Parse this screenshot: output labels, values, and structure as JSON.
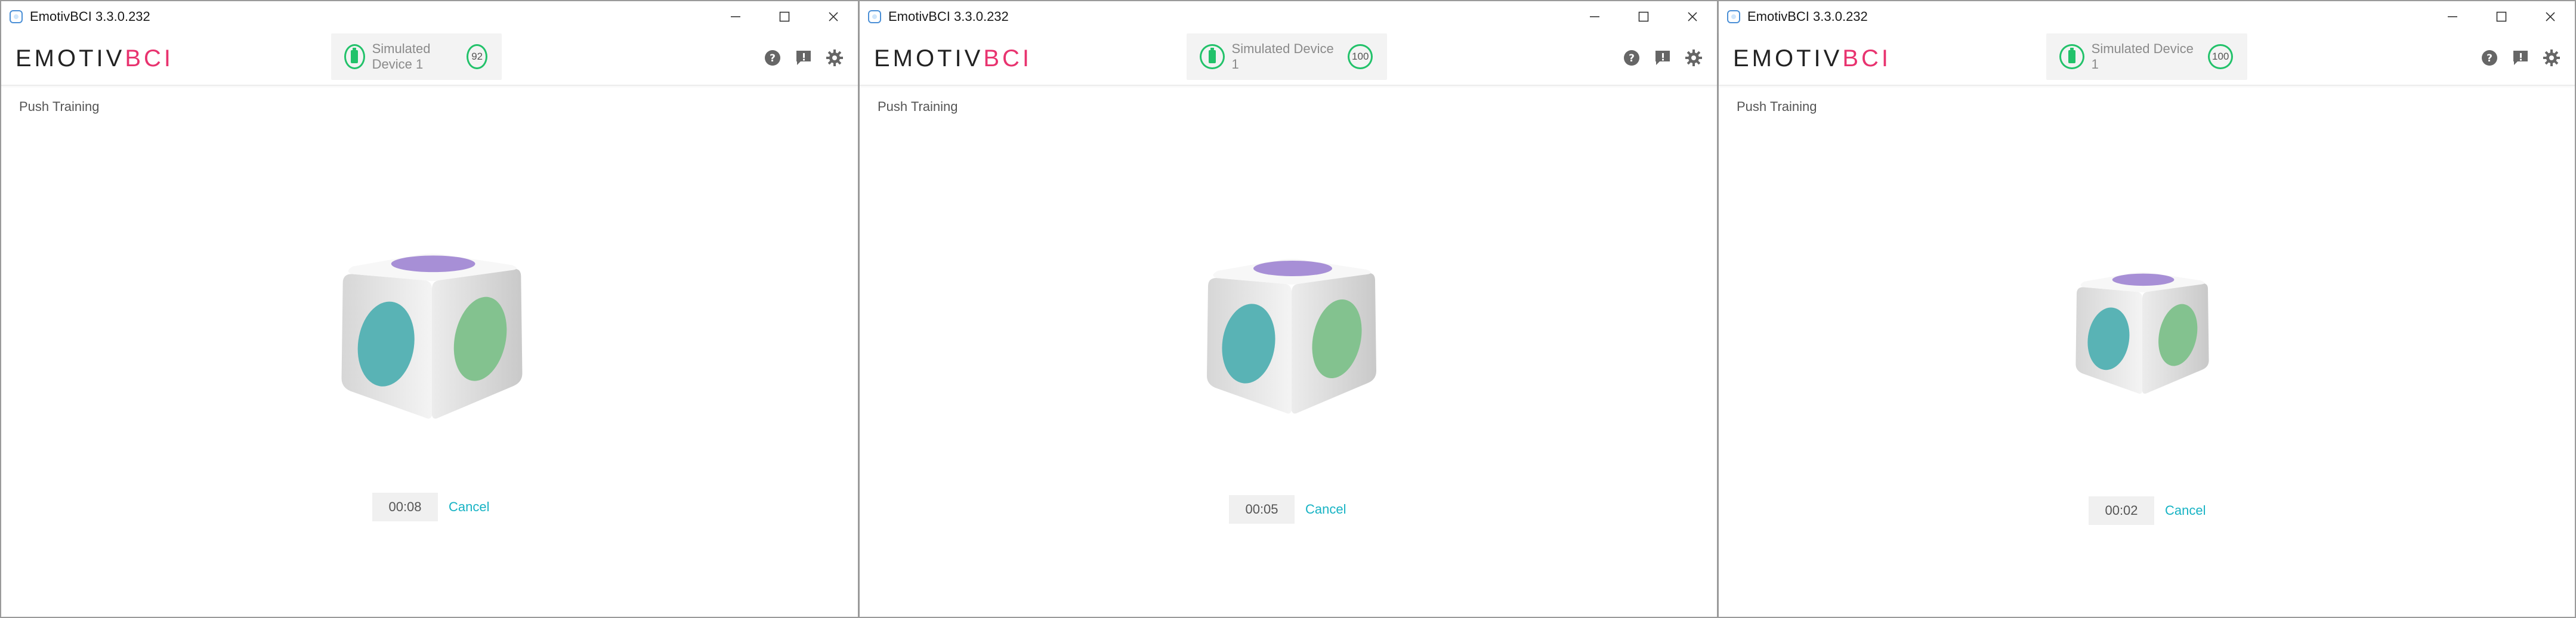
{
  "windows": [
    {
      "title": "EmotivBCI 3.3.0.232",
      "logo": {
        "part1": "EMOTIV",
        "part2": "BCI"
      },
      "device": {
        "name": "Simulated Device 1",
        "signal": "92"
      },
      "section": "Push Training",
      "timer": "00:08",
      "cancel_label": "Cancel"
    },
    {
      "title": "EmotivBCI 3.3.0.232",
      "logo": {
        "part1": "EMOTIV",
        "part2": "BCI"
      },
      "device": {
        "name": "Simulated Device 1",
        "signal": "100"
      },
      "section": "Push Training",
      "timer": "00:05",
      "cancel_label": "Cancel"
    },
    {
      "title": "EmotivBCI 3.3.0.232",
      "logo": {
        "part1": "EMOTIV",
        "part2": "BCI"
      },
      "device": {
        "name": "Simulated Device 1",
        "signal": "100"
      },
      "section": "Push Training",
      "timer": "00:02",
      "cancel_label": "Cancel"
    }
  ],
  "icons": {
    "app": "emotiv-app-icon",
    "minimize": "minimize-icon",
    "maximize": "maximize-icon",
    "close": "close-icon",
    "help": "help-icon",
    "feedback": "feedback-icon",
    "settings": "gear-icon",
    "battery": "battery-icon"
  },
  "colors": {
    "brand_pink": "#e8336f",
    "status_green": "#22c26a",
    "link_cyan": "#17b3c4",
    "cube_teal": "#59b3b5",
    "cube_green": "#83c28f",
    "cube_purple": "#a78fd6"
  }
}
